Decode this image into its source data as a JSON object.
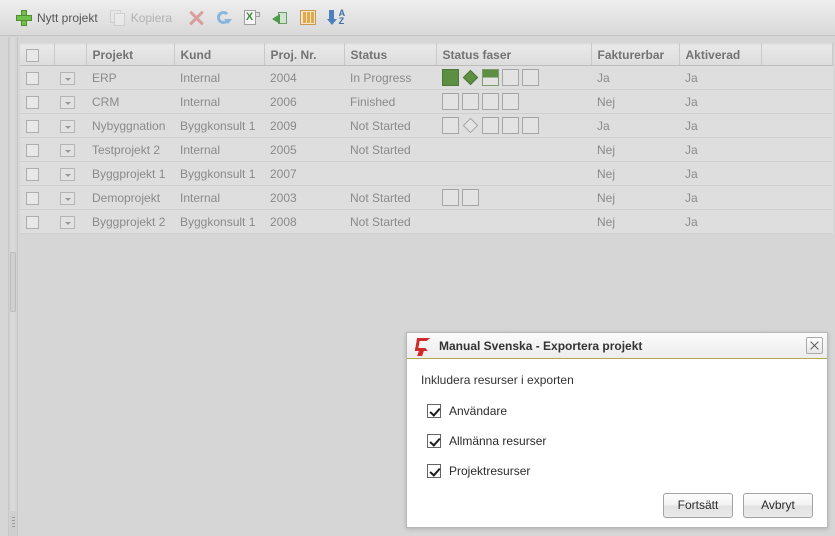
{
  "toolbar": {
    "buttons": [
      {
        "label": "Nytt projekt",
        "icon": "plus-icon",
        "disabled": false
      },
      {
        "label": "Kopiera",
        "icon": "copy-icon",
        "disabled": true
      }
    ],
    "icon_buttons": [
      {
        "name": "delete-icon",
        "title": "Ta bort"
      },
      {
        "name": "refresh-icon",
        "title": "Uppdatera"
      },
      {
        "name": "excel-export-icon",
        "title": "Exportera till Excel"
      },
      {
        "name": "import-icon",
        "title": "Importera"
      },
      {
        "name": "columns-icon",
        "title": "Kolumner"
      },
      {
        "name": "sort-az-icon",
        "title": "Sortera"
      }
    ]
  },
  "grid": {
    "columns": [
      "",
      "",
      "Projekt",
      "Kund",
      "Proj. Nr.",
      "Status",
      "Status faser",
      "Fakturerbar",
      "Aktiverad",
      ""
    ],
    "rows": [
      {
        "projekt": "ERP",
        "kund": "Internal",
        "nr": "2004",
        "status": "In Progress",
        "faser": [
          "full",
          "diamond-full",
          "half",
          "empty",
          "empty"
        ],
        "fakturerbar": "Ja",
        "aktiverad": "Ja"
      },
      {
        "projekt": "CRM",
        "kund": "Internal",
        "nr": "2006",
        "status": "Finished",
        "faser": [
          "empty",
          "empty",
          "empty",
          "empty"
        ],
        "fakturerbar": "Nej",
        "aktiverad": "Ja"
      },
      {
        "projekt": "Nybyggnation",
        "kund": "Byggkonsult 1",
        "nr": "2009",
        "status": "Not Started",
        "faser": [
          "empty",
          "diamond-empty",
          "empty",
          "empty",
          "empty"
        ],
        "fakturerbar": "Ja",
        "aktiverad": "Ja"
      },
      {
        "projekt": "Testprojekt 2",
        "kund": "Internal",
        "nr": "2005",
        "status": "Not Started",
        "faser": [],
        "fakturerbar": "Nej",
        "aktiverad": "Ja"
      },
      {
        "projekt": "Byggprojekt 1",
        "kund": "Byggkonsult 1",
        "nr": "2007",
        "status": "",
        "faser": [],
        "fakturerbar": "Nej",
        "aktiverad": "Ja"
      },
      {
        "projekt": "Demoprojekt",
        "kund": "Internal",
        "nr": "2003",
        "status": "Not Started",
        "faser": [
          "empty",
          "empty"
        ],
        "fakturerbar": "Nej",
        "aktiverad": "Ja"
      },
      {
        "projekt": "Byggprojekt 2",
        "kund": "Byggkonsult 1",
        "nr": "2008",
        "status": "Not Started",
        "faser": [],
        "fakturerbar": "Nej",
        "aktiverad": "Ja"
      }
    ]
  },
  "dialog": {
    "title": "Manual Svenska - Exportera projekt",
    "heading": "Inkludera resurser i exporten",
    "options": [
      {
        "label": "Användare",
        "checked": true
      },
      {
        "label": "Allmänna resurser",
        "checked": true
      },
      {
        "label": "Projektresurser",
        "checked": true
      }
    ],
    "primary_button": "Fortsätt",
    "secondary_button": "Avbryt",
    "close_icon": "close-icon"
  },
  "colors": {
    "phase_green": "#5c8f42",
    "logo_red": "#d02b2b",
    "title_accent": "#b7a84f",
    "app_background": "#d6d6d6"
  }
}
